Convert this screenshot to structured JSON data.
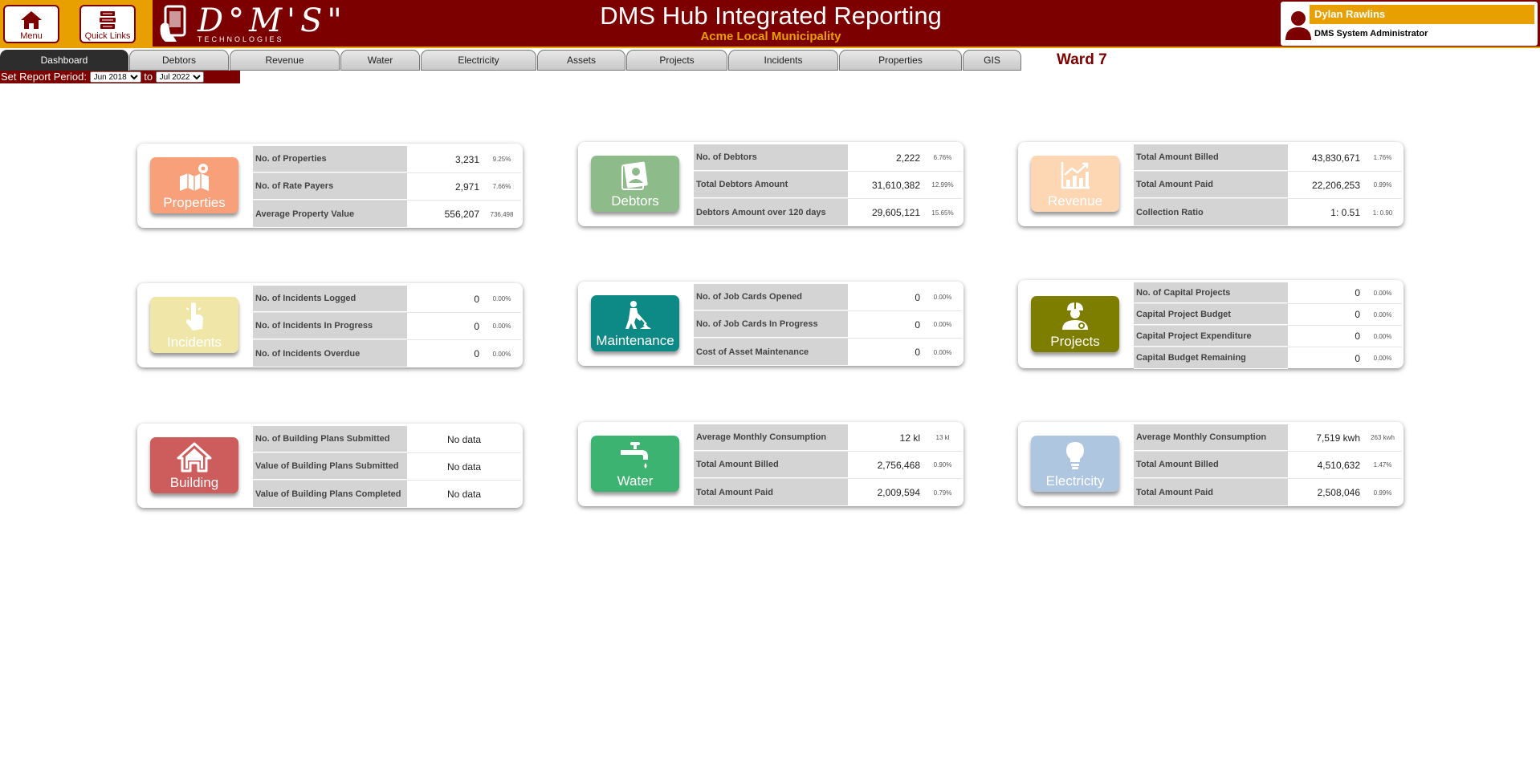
{
  "header": {
    "menu_label": "Menu",
    "quick_links_label": "Quick Links",
    "logo_text": "D°M'S\"",
    "logo_sub": "TECHNOLOGIES",
    "title": "DMS Hub Integrated Reporting",
    "subtitle": "Acme Local Municipality",
    "user_name": "Dylan Rawlins",
    "user_role": "DMS System Administrator"
  },
  "tabs": [
    "Dashboard",
    "Debtors",
    "Revenue",
    "Water",
    "Electricity",
    "Assets",
    "Projects",
    "Incidents",
    "Properties",
    "GIS"
  ],
  "ward": "Ward 7",
  "period": {
    "label": "Set Report Period:",
    "from": "Jun 2018",
    "to_label": "to",
    "to": "Jul 2022"
  },
  "colors": {
    "brand_dark": "#7d0000",
    "brand_accent": "#e8a000"
  },
  "cards": {
    "properties": {
      "tile_label": "Properties",
      "icon": "map-pin-icon",
      "color": "#f7a07a",
      "rows": [
        {
          "label": "No. of Properties",
          "value": "3,231",
          "pct": "9.25%"
        },
        {
          "label": "No. of Rate Payers",
          "value": "2,971",
          "pct": "7.66%"
        },
        {
          "label": "Average Property Value",
          "value": "556,207",
          "pct": "736,498"
        }
      ]
    },
    "debtors": {
      "tile_label": "Debtors",
      "icon": "id-card-icon",
      "color": "#8dbb8a",
      "rows": [
        {
          "label": "No. of Debtors",
          "value": "2,222",
          "pct": "6.76%"
        },
        {
          "label": "Total Debtors Amount",
          "value": "31,610,382",
          "pct": "12.99%"
        },
        {
          "label": "Debtors Amount over 120 days",
          "value": "29,605,121",
          "pct": "15.65%"
        }
      ]
    },
    "revenue": {
      "tile_label": "Revenue",
      "icon": "growth-chart-icon",
      "color": "#fdd6b4",
      "rows": [
        {
          "label": "Total Amount Billed",
          "value": "43,830,671",
          "pct": "1.76%"
        },
        {
          "label": "Total Amount Paid",
          "value": "22,206,253",
          "pct": "0.99%"
        },
        {
          "label": "Collection Ratio",
          "value": "1: 0.51",
          "pct": "1: 0.90"
        }
      ]
    },
    "incidents": {
      "tile_label": "Incidents",
      "icon": "tap-hand-icon",
      "color": "#efe6a8",
      "rows": [
        {
          "label": "No. of Incidents Logged",
          "value": "0",
          "pct": "0.00%"
        },
        {
          "label": "No. of Incidents In Progress",
          "value": "0",
          "pct": "0.00%"
        },
        {
          "label": "No. of Incidents Overdue",
          "value": "0",
          "pct": "0.00%"
        }
      ]
    },
    "maintenance": {
      "tile_label": "Maintenance",
      "icon": "worker-shovel-icon",
      "color": "#0e8a86",
      "rows": [
        {
          "label": "No. of Job Cards Opened",
          "value": "0",
          "pct": "0.00%"
        },
        {
          "label": "No. of Job Cards In Progress",
          "value": "0",
          "pct": "0.00%"
        },
        {
          "label": "Cost of Asset Maintenance",
          "value": "0",
          "pct": "0.00%"
        }
      ]
    },
    "projects": {
      "tile_label": "Projects",
      "icon": "engineer-icon",
      "color": "#7d7d00",
      "rows": [
        {
          "label": "No. of Capital Projects",
          "value": "0",
          "pct": "0.00%"
        },
        {
          "label": "Capital Project Budget",
          "value": "0",
          "pct": "0.00%"
        },
        {
          "label": "Capital Project Expenditure",
          "value": "0",
          "pct": "0.00%"
        },
        {
          "label": "Capital Budget Remaining",
          "value": "0",
          "pct": "0.00%"
        }
      ]
    },
    "building": {
      "tile_label": "Building",
      "icon": "house-icon",
      "color": "#cd5c5c",
      "rows": [
        {
          "label": "No. of Building Plans Submitted",
          "value": "No data"
        },
        {
          "label": "Value of Building Plans Submitted",
          "value": "No data"
        },
        {
          "label": "Value of Building Plans Completed",
          "value": "No data"
        }
      ]
    },
    "water": {
      "tile_label": "Water",
      "icon": "water-tap-icon",
      "color": "#3cb371",
      "rows": [
        {
          "label": "Average Monthly Consumption",
          "value": "12 kl",
          "pct": "13 kl"
        },
        {
          "label": "Total Amount Billed",
          "value": "2,756,468",
          "pct": "0.90%"
        },
        {
          "label": "Total Amount Paid",
          "value": "2,009,594",
          "pct": "0.79%"
        }
      ]
    },
    "electricity": {
      "tile_label": "Electricity",
      "icon": "light-bulb-icon",
      "color": "#aec6df",
      "rows": [
        {
          "label": "Average Monthly Consumption",
          "value": "7,519 kwh",
          "pct": "263 kwh"
        },
        {
          "label": "Total Amount Billed",
          "value": "4,510,632",
          "pct": "1.47%"
        },
        {
          "label": "Total Amount Paid",
          "value": "2,508,046",
          "pct": "0.99%"
        }
      ]
    }
  }
}
